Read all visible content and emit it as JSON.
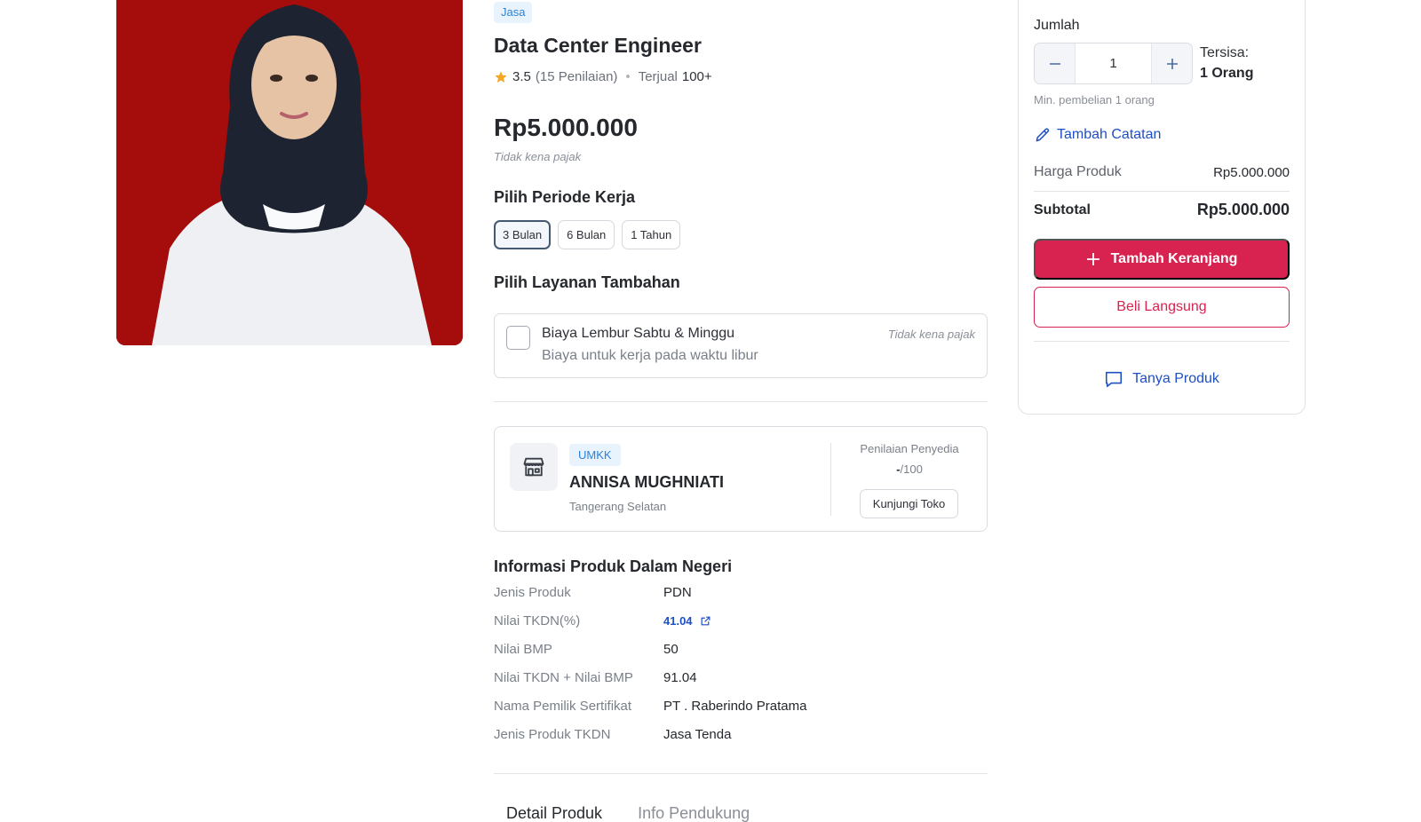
{
  "product": {
    "category_badge": "Jasa",
    "title": "Data Center Engineer",
    "rating": "3.5",
    "rating_count": "(15 Penilaian)",
    "sold_label": "Terjual",
    "sold_value": "100+",
    "price": "Rp5.000.000",
    "tax_note": "Tidak kena pajak",
    "image_alt": "Foto produk"
  },
  "period": {
    "heading": "Pilih Periode Kerja",
    "options": [
      "3 Bulan",
      "6 Bulan",
      "1 Tahun"
    ],
    "selected": "3 Bulan"
  },
  "addons": {
    "heading": "Pilih Layanan Tambahan",
    "items": [
      {
        "title": "Biaya Lembur Sabtu & Minggu",
        "desc": "Biaya untuk kerja pada waktu libur",
        "tax": "Tidak kena pajak",
        "checked": false
      }
    ]
  },
  "seller": {
    "badge": "UMKK",
    "name": "ANNISA MUGHNIATI",
    "location": "Tangerang Selatan",
    "score_label": "Penilaian Penyedia",
    "score_value": "-",
    "score_max": "/100",
    "visit_label": "Kunjungi Toko"
  },
  "domestic_info": {
    "heading": "Informasi Produk Dalam Negeri",
    "rows": [
      {
        "label": "Jenis Produk",
        "value": "PDN"
      },
      {
        "label": "Nilai TKDN(%)",
        "value": "41.04"
      },
      {
        "label": "Nilai BMP",
        "value": "50"
      },
      {
        "label": "Nilai TKDN + Nilai BMP",
        "value": "91.04"
      },
      {
        "label": "Nama Pemilik Sertifikat",
        "value": "PT . Raberindo Pratama"
      },
      {
        "label": "Jenis Produk TKDN",
        "value": "Jasa Tenda"
      }
    ]
  },
  "tabs": [
    "Detail Produk",
    "Info Pendukung"
  ],
  "purchase": {
    "qty_label": "Jumlah",
    "qty_value": "1",
    "remaining_label": "Tersisa:",
    "remaining_value": "1 Orang",
    "min_note": "Min. pembelian 1 orang",
    "add_note": "Tambah Catatan",
    "price_label": "Harga Produk",
    "price_value": "Rp5.000.000",
    "subtotal_label": "Subtotal",
    "subtotal_value": "Rp5.000.000",
    "add_cart": "Tambah Keranjang",
    "buy_now": "Beli Langsung",
    "ask": "Tanya Produk"
  },
  "colors": {
    "primary_red": "#d8224f",
    "link_blue": "#1f4fc4",
    "badge_blue": "#2b83d9",
    "star": "#f5a623",
    "photo_bg": "#a50c0c"
  },
  "icons": [
    "star-icon",
    "store-icon",
    "external-link-icon",
    "minus-icon",
    "plus-icon",
    "pencil-icon",
    "chat-icon"
  ]
}
